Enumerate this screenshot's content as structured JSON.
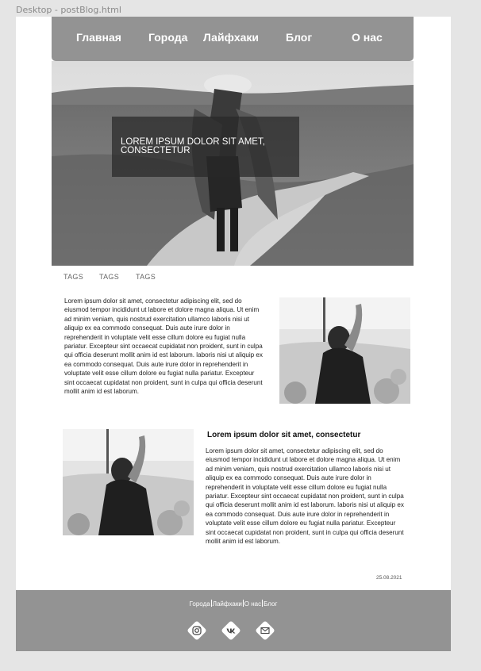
{
  "window": {
    "frame_label": "Desktop - postBlog.html"
  },
  "nav": {
    "items": [
      {
        "label": "Главная"
      },
      {
        "label": "Города"
      },
      {
        "label": "Лайфхаки"
      },
      {
        "label": "Блог"
      },
      {
        "label": "О нас"
      }
    ]
  },
  "hero": {
    "title": "LOREM IPSUM DOLOR SIT AMET, CONSECTETUR"
  },
  "tags": [
    "TAGS",
    "TAGS",
    "TAGS"
  ],
  "article": {
    "paragraph_1": "Lorem ipsum dolor sit amet, consectetur adipiscing elit, sed do eiusmod tempor incididunt ut labore et dolore magna aliqua. Ut enim ad minim veniam, quis nostrud exercitation ullamco laboris nisi ut aliquip ex ea commodo consequat. Duis aute irure dolor in reprehenderit in voluptate velit esse cillum dolore eu fugiat nulla pariatur. Excepteur sint occaecat cupidatat non proident, sunt in culpa qui officia deserunt mollit anim id est laborum. laboris nisi ut aliquip ex ea commodo consequat. Duis aute irure dolor in reprehenderit in voluptate velit esse cillum dolore eu fugiat nulla pariatur. Excepteur sint occaecat cupidatat non proident, sunt in culpa qui officia deserunt mollit anim id est laborum.",
    "subheading": "Lorem ipsum dolor sit amet, consectetur",
    "paragraph_2": "Lorem ipsum dolor sit amet, consectetur adipiscing elit, sed do eiusmod tempor incididunt ut labore et dolore magna aliqua. Ut enim ad minim veniam, quis nostrud exercitation ullamco laboris nisi ut aliquip ex ea commodo consequat. Duis aute irure dolor in reprehenderit in voluptate velit esse cillum dolore eu fugiat nulla pariatur. Excepteur sint occaecat cupidatat non proident, sunt in culpa qui officia deserunt mollit anim id est laborum. laboris nisi ut aliquip ex ea commodo consequat. Duis aute irure dolor in reprehenderit in voluptate velit esse cillum dolore eu fugiat nulla pariatur. Excepteur sint occaecat cupidatat non proident, sunt in culpa qui officia deserunt mollit anim id est laborum.",
    "date": "25.08.2021"
  },
  "footer": {
    "links": [
      {
        "label": "Города"
      },
      {
        "label": "Лайфхаки"
      },
      {
        "label": "О нас"
      },
      {
        "label": "Блог"
      }
    ],
    "social": [
      "instagram-icon",
      "vk-icon",
      "mail-icon"
    ]
  },
  "colors": {
    "nav_bg": "#939393",
    "footer_bg": "#939393",
    "page_bg": "#ffffff",
    "canvas_bg": "#e5e5e5"
  }
}
